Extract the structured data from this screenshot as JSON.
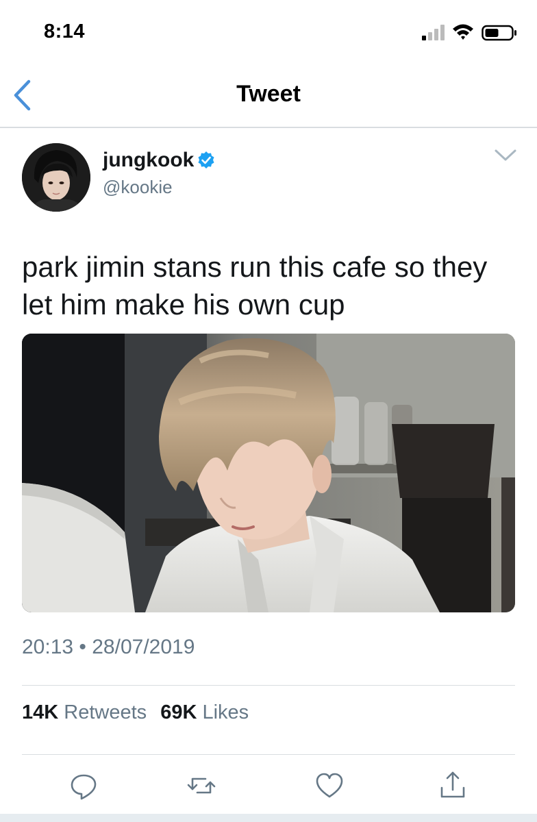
{
  "status_bar": {
    "time": "8:14"
  },
  "nav": {
    "title": "Tweet",
    "back_icon": "chevron-left-icon"
  },
  "tweet": {
    "author": {
      "name": "jungkook",
      "handle": "@kookie",
      "verified": true
    },
    "text": "park jimin stans run this cafe so they let him make his own cup",
    "timestamp": "20:13 • 28/07/2019",
    "stats": {
      "retweets_count": "14K",
      "retweets_label": "Retweets",
      "likes_count": "69K",
      "likes_label": "Likes"
    },
    "actions": [
      "reply-icon",
      "retweet-icon",
      "like-icon",
      "share-icon"
    ]
  },
  "colors": {
    "accent": "#4a90d9",
    "verified": "#1da1f2",
    "secondary_text": "#657786",
    "divider": "#d9dde0"
  }
}
